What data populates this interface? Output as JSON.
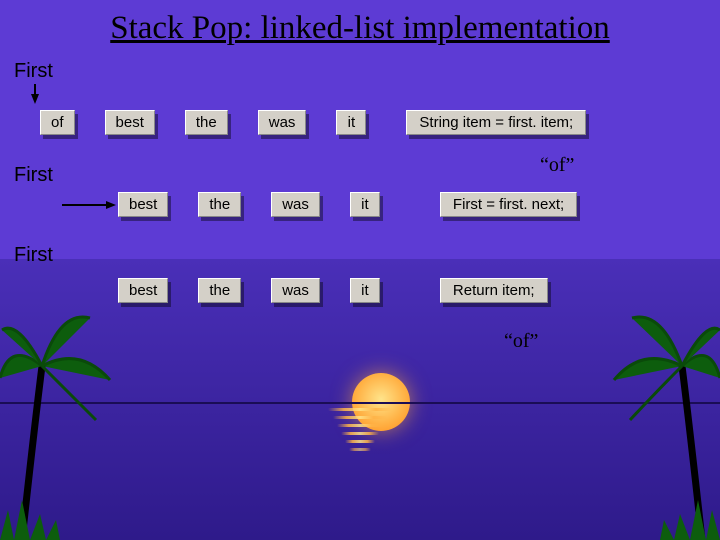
{
  "title": "Stack Pop: linked-list implementation",
  "labels": {
    "first": "First"
  },
  "rows": [
    {
      "nodes": [
        "of",
        "best",
        "the",
        "was",
        "it"
      ],
      "code": "String item = first. item;"
    },
    {
      "nodes": [
        "best",
        "the",
        "was",
        "it"
      ],
      "code": "First = first. next;"
    },
    {
      "nodes": [
        "best",
        "the",
        "was",
        "it"
      ],
      "code": "Return item;"
    }
  ],
  "annotations": {
    "of_top": "“of”",
    "of_bottom": "“of”"
  }
}
